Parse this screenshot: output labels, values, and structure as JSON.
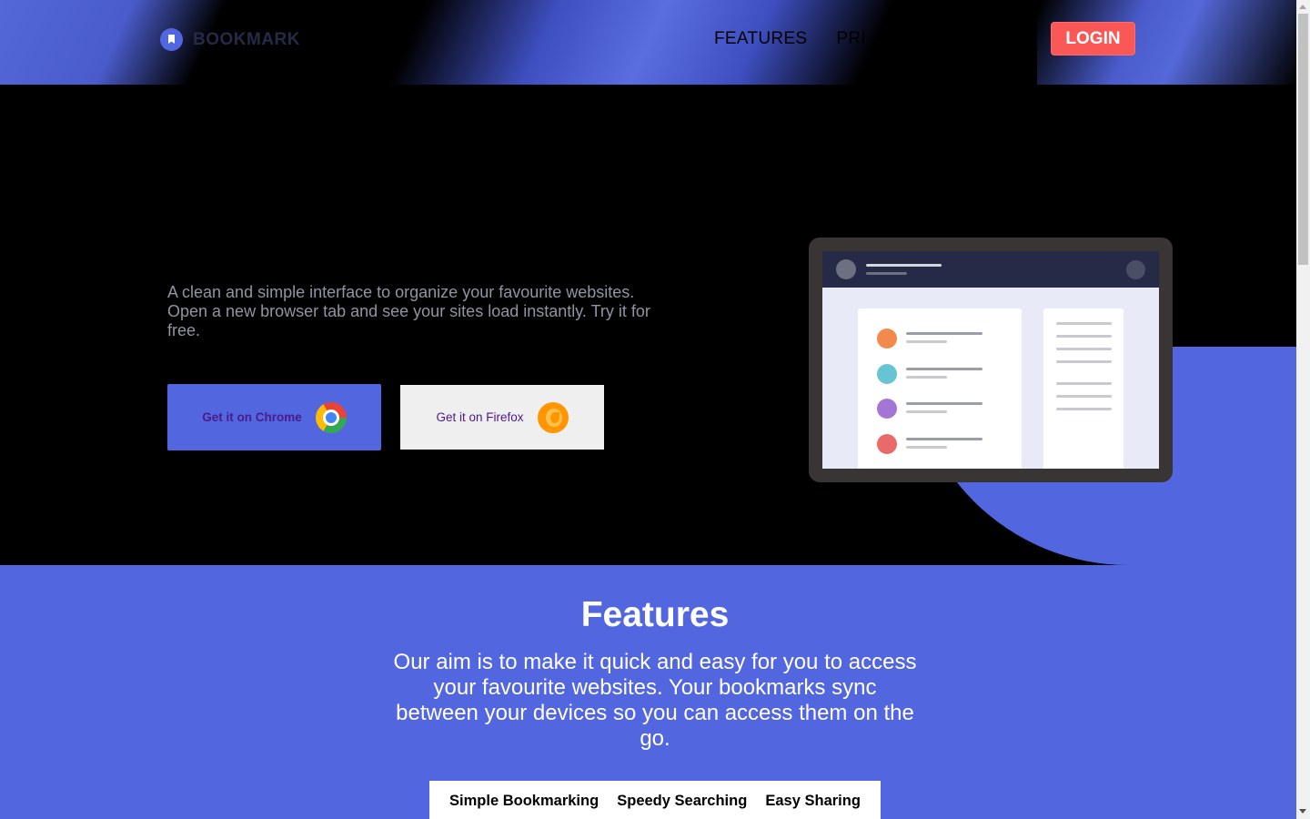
{
  "header": {
    "logo_text": "BOOKMARK",
    "nav": [
      {
        "label": "FEATURES"
      },
      {
        "label": "PRI"
      }
    ],
    "login_label": "LOGIN"
  },
  "hero": {
    "description": "A clean and simple interface to organize your favourite websites. Open a new browser tab and see your sites load instantly. Try it for free.",
    "chrome_button": "Get it on Chrome",
    "firefox_button": "Get it on Firefox"
  },
  "features": {
    "title": "Features",
    "description": "Our aim is to make it quick and easy for you to access your favourite websites. Your bookmarks sync between your devices so you can access them on the go.",
    "tabs": [
      "Simple Bookmarking",
      "Speedy Searching",
      "Easy Sharing"
    ]
  },
  "colors": {
    "accent": "#5267df",
    "login": "#fa5757",
    "row_dots": [
      "#f28a4b",
      "#67c5d3",
      "#a376d5",
      "#ea6a6a"
    ]
  },
  "icons": [
    "bookmark-logo-icon",
    "chrome-icon",
    "firefox-icon"
  ]
}
